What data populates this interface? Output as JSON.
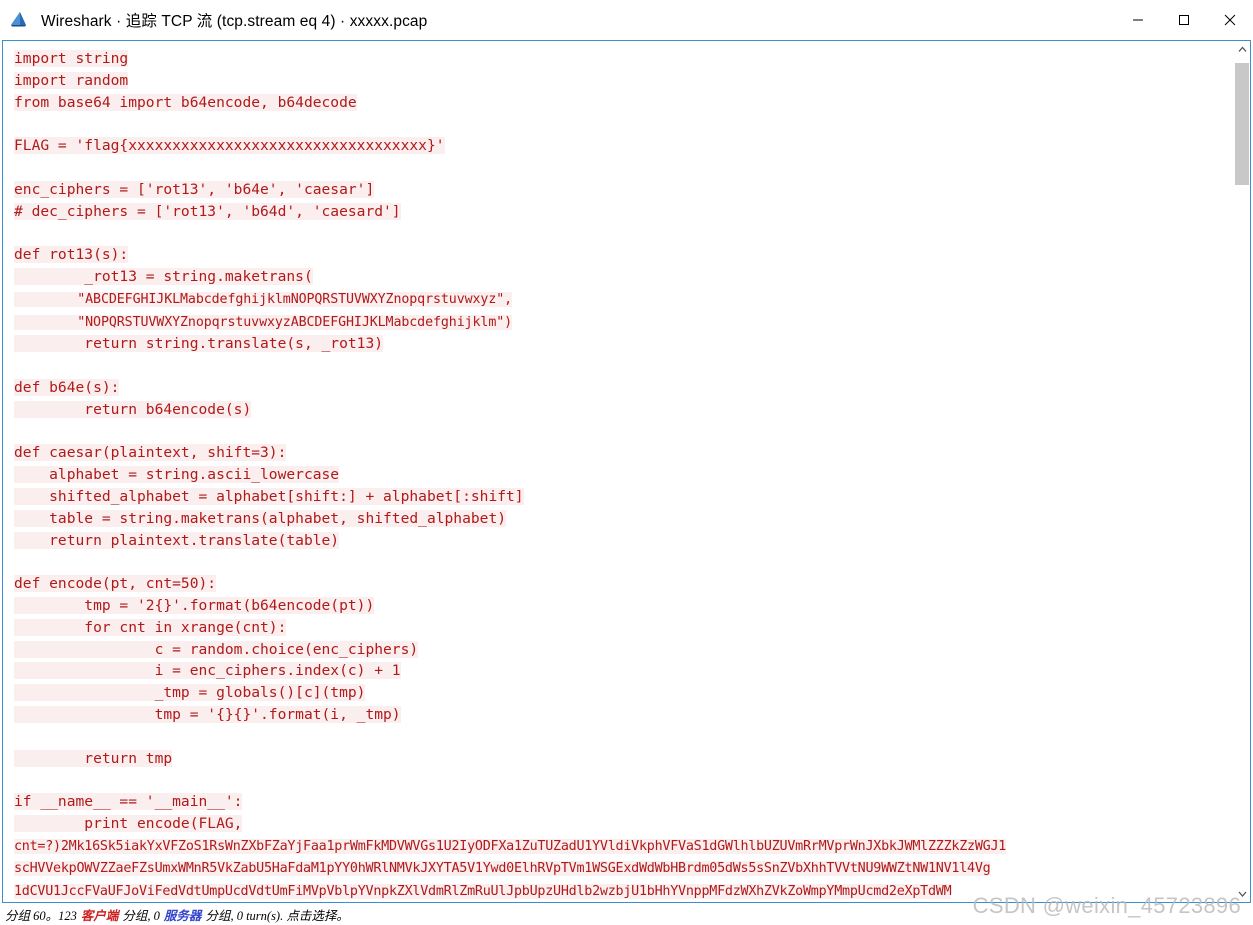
{
  "window": {
    "title": "Wireshark · 追踪 TCP 流 (tcp.stream eq 4) · xxxxx.pcap",
    "logo_name": "wireshark-logo",
    "controls": {
      "minimize": "—",
      "maximize": "□",
      "close": "✕"
    }
  },
  "code": {
    "lines": [
      "import string",
      "import random",
      "from base64 import b64encode, b64decode",
      "",
      "FLAG = 'flag{xxxxxxxxxxxxxxxxxxxxxxxxxxxxxxxxxx}'",
      "",
      "enc_ciphers = ['rot13', 'b64e', 'caesar']",
      "# dec_ciphers = ['rot13', 'b64d', 'caesard']",
      "",
      "def rot13(s):",
      "        _rot13 = string.maketrans(",
      "        \"ABCDEFGHIJKLMabcdefghijklmNOPQRSTUVWXYZnopqrstuvwxyz\",",
      "        \"NOPQRSTUVWXYZnopqrstuvwxyzABCDEFGHIJKLMabcdefghijklm\")",
      "        return string.translate(s, _rot13)",
      "",
      "def b64e(s):",
      "        return b64encode(s)",
      "",
      "def caesar(plaintext, shift=3):",
      "    alphabet = string.ascii_lowercase",
      "    shifted_alphabet = alphabet[shift:] + alphabet[:shift]",
      "    table = string.maketrans(alphabet, shifted_alphabet)",
      "    return plaintext.translate(table)",
      "",
      "def encode(pt, cnt=50):",
      "        tmp = '2{}'.format(b64encode(pt))",
      "        for cnt in xrange(cnt):",
      "                c = random.choice(enc_ciphers)",
      "                i = enc_ciphers.index(c) + 1",
      "                _tmp = globals()[c](tmp)",
      "                tmp = '{}{}'.format(i, _tmp)",
      "",
      "        return tmp",
      "",
      "if __name__ == '__main__':",
      "        print encode(FLAG,"
    ],
    "narrow_line_indexes": [
      11,
      12
    ],
    "b64_output_lines": [
      "cnt=?)2Mk16Sk5iakYxVFZoS1RsWnZXbFZaYjFaa1prWmFkMDVWVGs1U2IyODFXa1ZuTUZadU1YVldiVkphVFVaS1dGWlhlbUZUVmRrMVprWnJXbkJWMlZZZkZzWGJ1",
      "scHVVekpOWVZZaeFZsUmxWMnR5VkZabU5HaFdaM1pYY0hWRlNMVkJXYTA5V1Ywd0ElhRVpTVm1WSGExdWdWbHBrdm05dWs5sSnZVbXhhTVVtNU9WWZtNW1NV1l4Vg",
      "1dCVU1JccFVaUFJoViFedVdtUmpUcdVdtUmFiMVpVblpYVnpkZXlVdmRlZmRuUlJpbUpzUHdlb2wzbjU1bHhYVnppMFdzWXhZVkZoWmpYMmpUcmd2eXpTdWM"
    ]
  },
  "scrollbar": {
    "up_arrow": "up-arrow-icon",
    "down_arrow": "down-arrow-icon"
  },
  "statusbar": {
    "part1": "分组 60。123",
    "client": "客户端",
    "part2": "分组, 0",
    "server": "服务器",
    "part3": "分组, 0 turn(s). 点击选择。"
  },
  "watermark": {
    "text": "CSDN @weixin_45723896"
  },
  "colors": {
    "code_text": "#b01a1a",
    "code_highlight": "#fbeeee",
    "focus_border": "#3a8fd0",
    "client_label": "#cc2222",
    "server_label": "#3344cc"
  }
}
